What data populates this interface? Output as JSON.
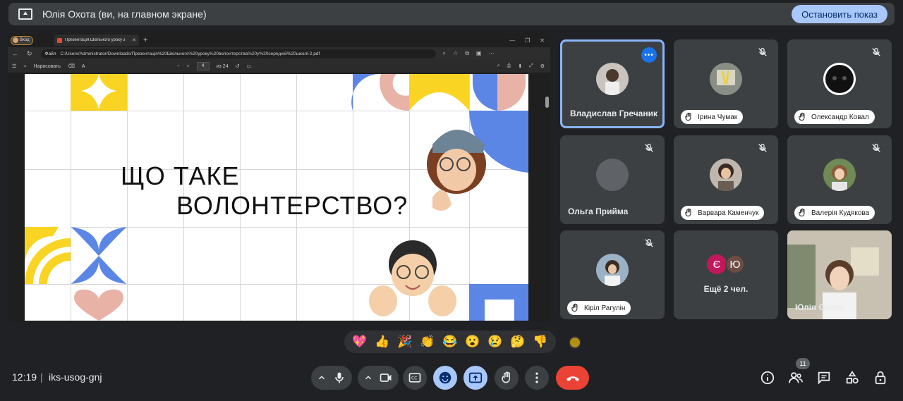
{
  "banner": {
    "text": "Юлія Охота (ви, на главном экране)",
    "stop_label": "Остановить показ"
  },
  "browser": {
    "profile_label": "Вход",
    "tab_title": "Презентація Шкільного уроку з",
    "url_prefix": "Файл",
    "url": "C:/Users/Administrator/Downloads/Презентація%20Шкільного%20уроку%20волонтерства%20у%20середній%20школі-2.pdf",
    "draw_label": "Нарисовать",
    "page_number": "4",
    "page_total": "из 24"
  },
  "slide": {
    "line1": "ЩО ТАКЕ",
    "line2": "ВОЛОНТЕРСТВО?"
  },
  "participants": [
    {
      "name": "Владислав Гречаник"
    },
    {
      "name": "Ірина Чумак"
    },
    {
      "name": "Олександр Ковал"
    },
    {
      "name": "Ольга Прийма"
    },
    {
      "name": "Варвара Каменчук"
    },
    {
      "name": "Валерія Кудякова"
    },
    {
      "name": "Кіріл Рагулін"
    },
    {
      "name": "Ещё 2 чел.",
      "initials": [
        "Є",
        "Ю"
      ]
    },
    {
      "name": "Юлія Охота"
    }
  ],
  "reactions": [
    "💖",
    "👍",
    "🎉",
    "👏",
    "😂",
    "😮",
    "😢",
    "🤔",
    "👎"
  ],
  "colors": {
    "accent": "#a8c7fa",
    "end_call": "#ea4335",
    "tile_bg": "#3c4043",
    "slide_yellow": "#f9d423",
    "slide_blue": "#5b86e5",
    "slide_pink": "#e8b2a6"
  },
  "bottom": {
    "time": "12:19",
    "separator": "|",
    "meeting_code": "iks-usog-gnj",
    "people_count": "11"
  },
  "icons": [
    "mic-icon",
    "camera-icon",
    "captions-icon",
    "emoji-icon",
    "present-icon",
    "raise-hand-icon",
    "more-options-icon",
    "end-call-icon",
    "info-icon",
    "people-icon",
    "chat-icon",
    "activities-icon",
    "host-controls-icon"
  ]
}
